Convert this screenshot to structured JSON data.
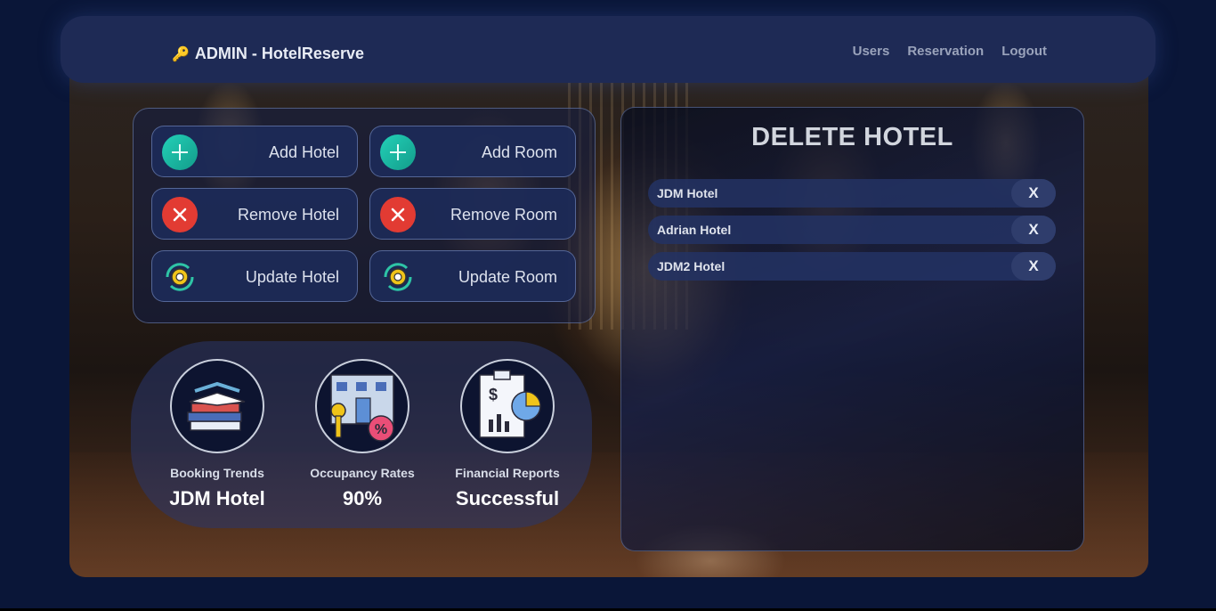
{
  "header": {
    "brand": "ADMIN - HotelReserve",
    "brand_icon": "key-icon",
    "nav": [
      "Users",
      "Reservation",
      "Logout"
    ]
  },
  "actions": [
    {
      "label": "Add Hotel",
      "icon": "plus-icon",
      "color": "#1cc2aa"
    },
    {
      "label": "Add Room",
      "icon": "plus-icon",
      "color": "#1cc2aa"
    },
    {
      "label": "Remove Hotel",
      "icon": "close-icon",
      "color": "#e23b33"
    },
    {
      "label": "Remove Room",
      "icon": "close-icon",
      "color": "#e23b33"
    },
    {
      "label": "Update Hotel",
      "icon": "gear-refresh-icon",
      "color": "#f0c419"
    },
    {
      "label": "Update Room",
      "icon": "gear-refresh-icon",
      "color": "#f0c419"
    }
  ],
  "stats": [
    {
      "caption": "Booking Trends",
      "value": "JDM Hotel",
      "icon": "books-icon"
    },
    {
      "caption": "Occupancy Rates",
      "value": "90%",
      "icon": "building-key-percent-icon"
    },
    {
      "caption": "Financial Reports",
      "value": "Successful",
      "icon": "report-chart-icon"
    }
  ],
  "delete_panel": {
    "title": "DELETE HOTEL",
    "hotels": [
      "JDM Hotel",
      "Adrian Hotel",
      "JDM2 Hotel"
    ],
    "remove_label": "X"
  }
}
